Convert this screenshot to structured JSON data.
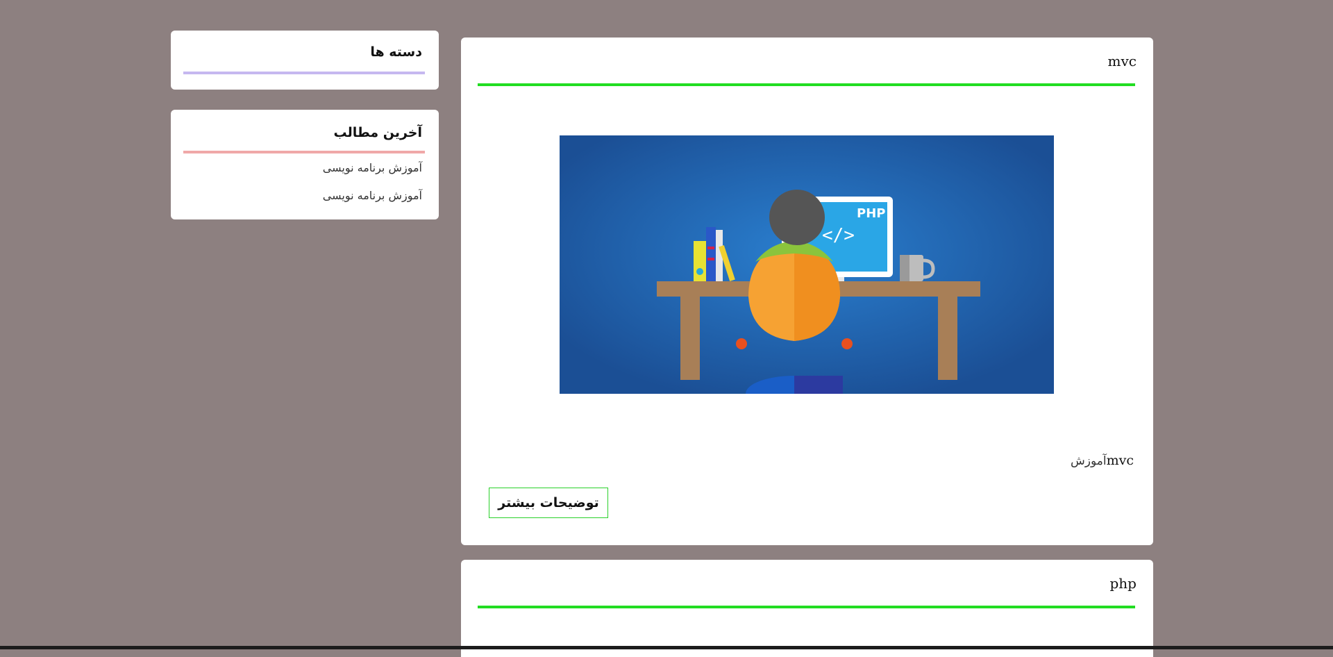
{
  "sidebar": {
    "categories": {
      "title": "دسته ها",
      "accent": "#c6b8f0"
    },
    "latest": {
      "title": "آخرین مطالب",
      "accent": "#f0a8a8",
      "items": [
        {
          "label": "آموزش برنامه نویسی"
        },
        {
          "label": "آموزش برنامه نویسی"
        }
      ]
    }
  },
  "posts": [
    {
      "title": "mvc",
      "accent": "#22dd22",
      "image": "php-developer-illustration",
      "image_text": {
        "badge": "PHP",
        "code": "</>"
      },
      "excerpt_word": "آموزش",
      "excerpt_latin": "mvc",
      "more_label": "توضیحات بیشتر"
    },
    {
      "title": "php",
      "accent": "#22dd22"
    }
  ],
  "colors": {
    "background": "#8d8080",
    "card": "#ffffff",
    "button_border": "#2ad12a"
  }
}
